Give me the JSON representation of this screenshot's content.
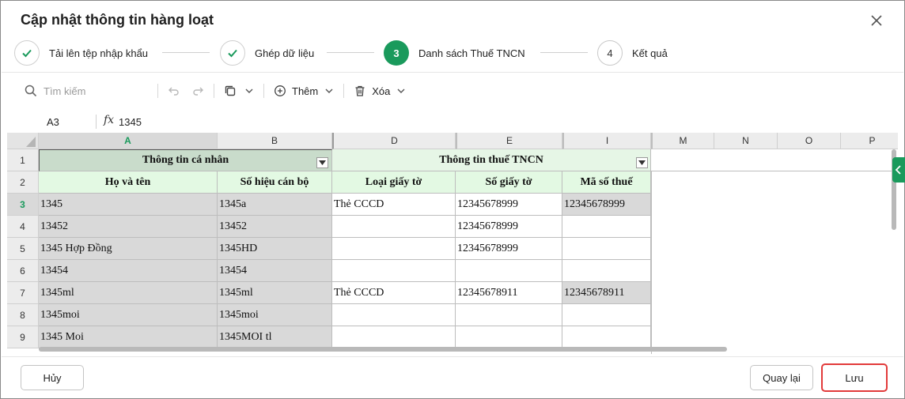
{
  "dialog": {
    "title": "Cập nhật thông tin hàng loạt"
  },
  "stepper": {
    "steps": [
      {
        "number": "1",
        "label": "Tải lên tệp nhập khẩu",
        "state": "done"
      },
      {
        "number": "2",
        "label": "Ghép dữ liệu",
        "state": "done"
      },
      {
        "number": "3",
        "label": "Danh sách Thuế TNCN",
        "state": "active"
      },
      {
        "number": "4",
        "label": "Kết quả",
        "state": "todo"
      }
    ]
  },
  "toolbar": {
    "search_placeholder": "Tìm kiếm",
    "add_label": "Thêm",
    "delete_label": "Xóa"
  },
  "formula_bar": {
    "cell_ref": "A3",
    "fx": "fx",
    "value": "1345"
  },
  "sheet": {
    "col_headers": [
      "A",
      "B",
      "D",
      "E",
      "I",
      "M",
      "N",
      "O",
      "P"
    ],
    "row_headers": [
      "1",
      "2",
      "3",
      "4",
      "5",
      "6",
      "7",
      "8",
      "9"
    ],
    "groups": [
      {
        "label": "Thông tin cá nhân"
      },
      {
        "label": "Thông tin thuế TNCN"
      }
    ],
    "headers": [
      "Họ và tên",
      "Số hiệu cán bộ",
      "Loại giấy tờ",
      "Số giấy tờ",
      "Mã số thuế"
    ],
    "rows": [
      [
        "1345",
        "1345a",
        "Thẻ CCCD",
        "12345678999",
        "12345678999"
      ],
      [
        "13452",
        "13452",
        "",
        "12345678999",
        ""
      ],
      [
        "1345 Hợp Đồng",
        "1345HD",
        "",
        "12345678999",
        ""
      ],
      [
        "13454",
        "13454",
        "",
        "",
        ""
      ],
      [
        "1345ml",
        "1345ml",
        "Thẻ CCCD",
        "12345678911",
        "12345678911"
      ],
      [
        "1345moi",
        "1345moi",
        "",
        "",
        ""
      ],
      [
        "1345 Moi",
        "1345MOI tl",
        "",
        "",
        ""
      ]
    ]
  },
  "footer": {
    "cancel_label": "Hủy",
    "back_label": "Quay lại",
    "save_label": "Lưu"
  },
  "colors": {
    "accent": "#1a9a5c",
    "highlight": "#e23a3a",
    "header_green": "#e3f9e3",
    "grey_cell": "#d9d9d9"
  }
}
